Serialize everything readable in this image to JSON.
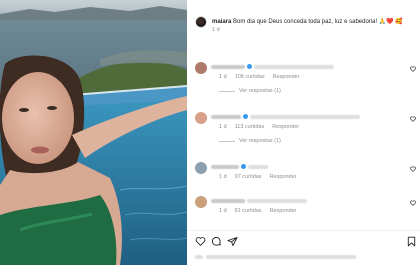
{
  "post": {
    "username": "maiara",
    "caption": "Bom dia que Deus conceda toda paz, luz e sabedoria! ",
    "caption_emoji": "🙏❤️",
    "caption_tail": "🥰",
    "age": "1 d"
  },
  "comments": [
    {
      "age": "1 d",
      "likes": "108 curtidas",
      "reply_label": "Responder",
      "view_replies": "Ver respostas (1)",
      "avatar_color": "#b07a6a"
    },
    {
      "age": "1 d",
      "likes": "113 curtidas",
      "reply_label": "Responder",
      "view_replies": "Ver respostas (1)",
      "avatar_color": "#d9a089"
    },
    {
      "age": "1 d",
      "likes": "97 curtidas",
      "reply_label": "Responder",
      "avatar_color": "#8aa0b0"
    },
    {
      "age": "1 d",
      "likes": "81 curtidas",
      "reply_label": "Responder",
      "avatar_color": "#c9a07a"
    }
  ],
  "icons": {
    "like": "heart-icon",
    "comment": "comment-icon",
    "share": "share-icon",
    "save": "bookmark-icon"
  },
  "colors": {
    "muted_text": "#8e8e8e",
    "verified": "#3897f0",
    "pool_water": "#2f7fa3"
  }
}
